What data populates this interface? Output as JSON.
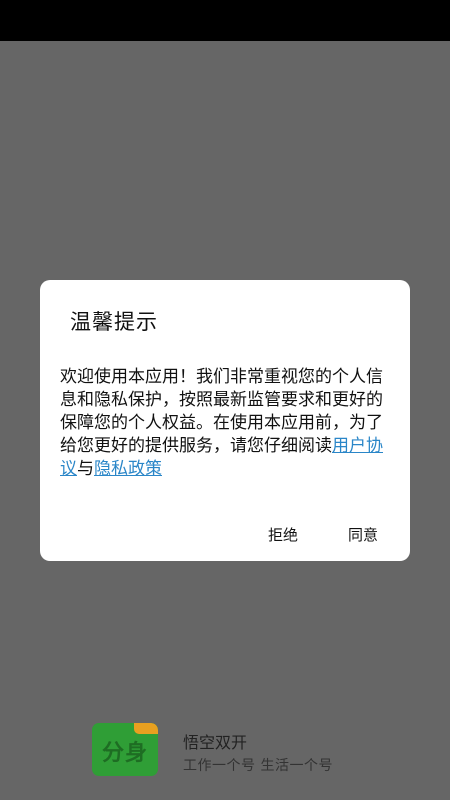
{
  "dialog": {
    "title": "温馨提示",
    "body_text": "欢迎使用本应用！我们非常重视您的个人信息和隐私保护，按照最新监管要求和更好的保障您的个人权益。在使用本应用前，为了给您更好的提供服务，请您仔细阅读",
    "user_agreement_link": "用户协议",
    "connector": "与",
    "privacy_policy_link": "隐私政策",
    "reject_label": "拒绝",
    "agree_label": "同意"
  },
  "app": {
    "icon_text": "分身",
    "name": "悟空双开",
    "slogan": "工作一个号 生活一个号"
  },
  "colors": {
    "overlay": "#666666",
    "link": "#2a86c8",
    "icon_green": "#2f9e36"
  }
}
